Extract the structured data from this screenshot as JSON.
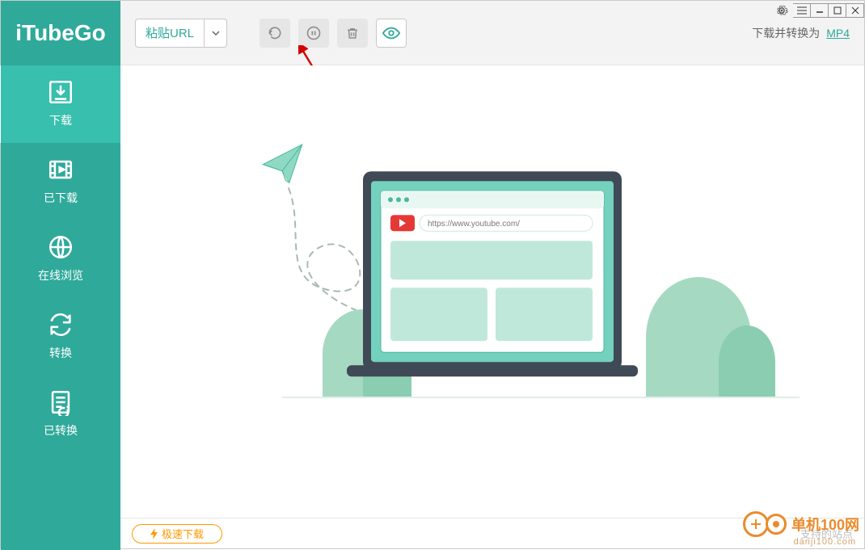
{
  "app": {
    "name": "iTubeGo"
  },
  "sidebar": {
    "items": [
      {
        "label": "下载"
      },
      {
        "label": "已下载"
      },
      {
        "label": "在线浏览"
      },
      {
        "label": "转换"
      },
      {
        "label": "已转换"
      }
    ]
  },
  "toolbar": {
    "paste_url_label": "粘贴URL",
    "convert_prefix": "下载并转换为",
    "format_link": "MP4"
  },
  "illustration": {
    "url_placeholder": "https://www.youtube.com/"
  },
  "bottom": {
    "fast_download_label": "极速下载",
    "supported_sites_label": "支持的站点"
  },
  "watermark": {
    "brand": "单机100网",
    "domain": "danji100.com"
  },
  "icons": {
    "download": "download-icon",
    "downloaded": "film-icon",
    "browse": "globe-icon",
    "convert": "refresh-icon",
    "converted": "file-check-icon",
    "undo": "undo-icon",
    "pause": "pause-icon",
    "trash": "trash-icon",
    "eye": "eye-icon",
    "gear": "gear-icon",
    "menu": "menu-icon",
    "min": "minimize-icon",
    "max": "maximize-icon",
    "close": "close-icon",
    "chevron": "chevron-down-icon",
    "bolt": "bolt-icon",
    "plus": "plus-icon"
  }
}
